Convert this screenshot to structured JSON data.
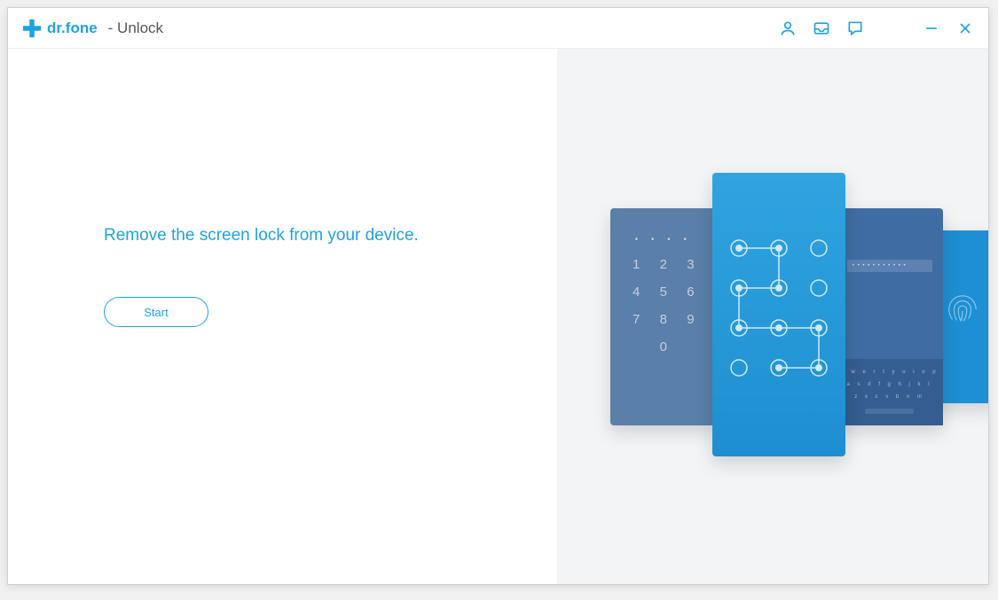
{
  "titlebar": {
    "app_name": "dr.fone",
    "module_name": "- Unlock"
  },
  "main": {
    "headline": "Remove the screen lock from your device.",
    "start_label": "Start"
  },
  "phones": {
    "pin": {
      "dots": "• • • •",
      "keys": [
        "1",
        "2",
        "3",
        "4",
        "5",
        "6",
        "7",
        "8",
        "9",
        "0"
      ]
    },
    "password": {
      "masked": "• • • • • • • • • • •",
      "kbd_row1": "q w e r t y u i o p",
      "kbd_row2": "a s d f g h j k l",
      "kbd_row3": "z x c v b n m"
    }
  }
}
